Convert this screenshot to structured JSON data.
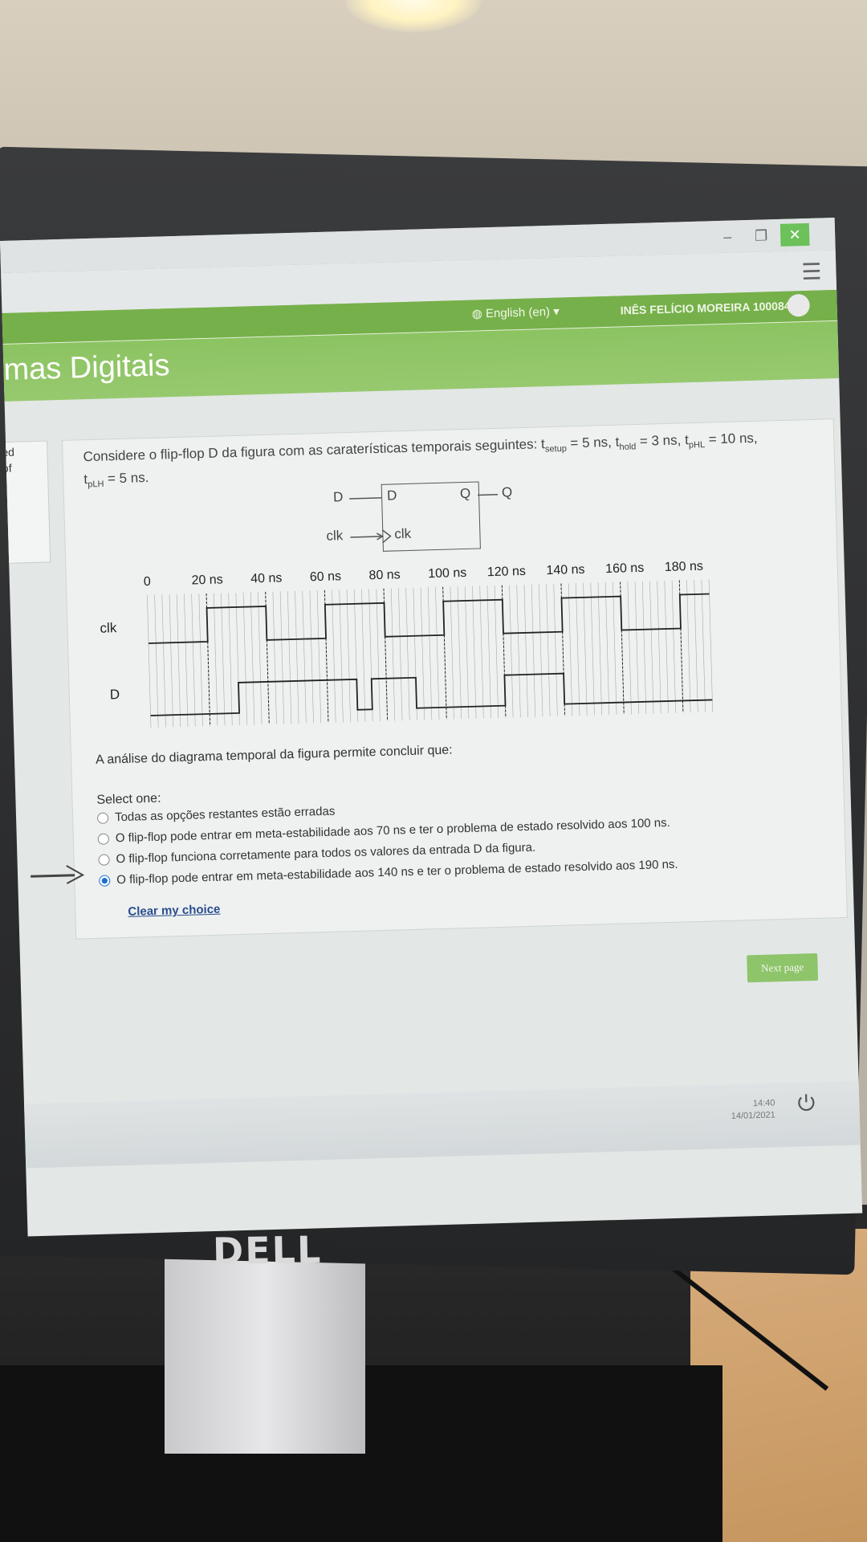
{
  "window": {
    "minimize_glyph": "–",
    "restore_glyph": "❐",
    "close_glyph": "✕"
  },
  "header": {
    "language": "English (en) ▾",
    "user_name": "INÊS FELÍCIO MOREIRA 100084",
    "course_title": "mas Digitais"
  },
  "left_card": {
    "line1": "ed",
    "line2": "of"
  },
  "question": {
    "text_intro": "Considere o flip-flop D da figura com as caraterísticas temporais seguintes: t",
    "setup_sub": "setup",
    "setup_val": " = 5 ns, t",
    "hold_sub": "hold",
    "hold_val": " = 3 ns, t",
    "phl_sub": "pHL",
    "phl_val": " = 10 ns,",
    "t_prefix": "t",
    "plh_sub": "pLH",
    "plh_val": " = 5 ns.",
    "flipflop": {
      "in_d": "D",
      "in_clk": "clk",
      "box_d": "D",
      "box_q": "Q",
      "box_clk": "clk",
      "out_q": "Q"
    },
    "analysis": "A análise do diagrama temporal da figura permite concluir que:",
    "select_one": "Select one:",
    "options": [
      {
        "label": "Todas as opções restantes estão erradas",
        "checked": false
      },
      {
        "label": "O flip-flop pode entrar em meta-estabilidade aos 70 ns e ter o problema de estado resolvido aos 100 ns.",
        "checked": false
      },
      {
        "label": "O flip-flop funciona corretamente para todos os valores da entrada D da figura.",
        "checked": false
      },
      {
        "label": "O flip-flop pode entrar em meta-estabilidade aos 140 ns e ter o problema de estado resolvido aos 190 ns.",
        "checked": true
      }
    ],
    "clear_choice": "Clear my choice"
  },
  "next_page": "Next page",
  "taskbar": {
    "time": "14:40",
    "date": "14/01/2021"
  },
  "brand": "DELL",
  "chart_data": {
    "type": "line",
    "title": "",
    "xlabel": "",
    "ylabel": "",
    "x_tick_labels": [
      "0",
      "20 ns",
      "40 ns",
      "60 ns",
      "80 ns",
      "100 ns",
      "120 ns",
      "140 ns",
      "160 ns",
      "180 ns"
    ],
    "x_range_ns": [
      0,
      190
    ],
    "series": [
      {
        "name": "clk",
        "points": [
          [
            0,
            0
          ],
          [
            20,
            0
          ],
          [
            20,
            1
          ],
          [
            40,
            1
          ],
          [
            40,
            0
          ],
          [
            60,
            0
          ],
          [
            60,
            1
          ],
          [
            80,
            1
          ],
          [
            80,
            0
          ],
          [
            100,
            0
          ],
          [
            100,
            1
          ],
          [
            120,
            1
          ],
          [
            120,
            0
          ],
          [
            140,
            0
          ],
          [
            140,
            1
          ],
          [
            160,
            1
          ],
          [
            160,
            0
          ],
          [
            180,
            0
          ],
          [
            180,
            1
          ],
          [
            190,
            1
          ]
        ]
      },
      {
        "name": "D",
        "points": [
          [
            0,
            0
          ],
          [
            30,
            0
          ],
          [
            30,
            1
          ],
          [
            70,
            1
          ],
          [
            70,
            0
          ],
          [
            75,
            0
          ],
          [
            75,
            1
          ],
          [
            90,
            1
          ],
          [
            90,
            0
          ],
          [
            120,
            0
          ],
          [
            120,
            1
          ],
          [
            140,
            1
          ],
          [
            140,
            0
          ],
          [
            190,
            0
          ]
        ]
      }
    ]
  }
}
